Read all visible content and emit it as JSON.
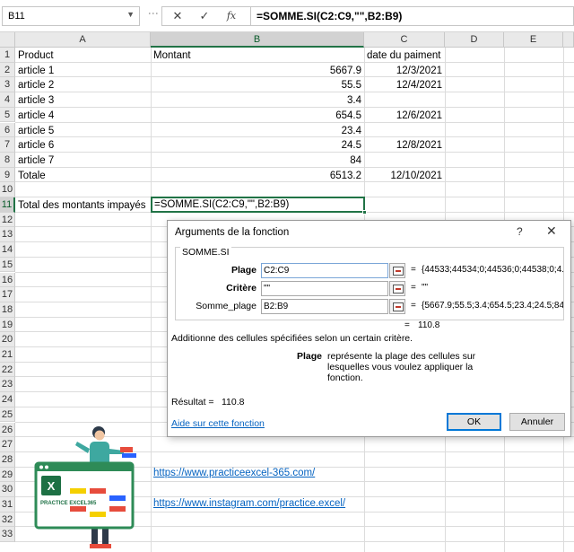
{
  "formula_bar": {
    "name_box": "B11",
    "cancel_glyph": "✕",
    "enter_glyph": "✓",
    "fx_glyph": "fx",
    "formula": "=SOMME.SI(C2:C9,\"\",B2:B9)"
  },
  "columns": [
    "A",
    "B",
    "C",
    "D",
    "E"
  ],
  "rows": [
    "1",
    "2",
    "3",
    "4",
    "5",
    "6",
    "7",
    "8",
    "9",
    "10",
    "11",
    "12",
    "13",
    "14",
    "15",
    "16",
    "17",
    "18",
    "19",
    "20",
    "21",
    "22",
    "23",
    "24",
    "25",
    "26",
    "27",
    "28",
    "29",
    "30",
    "31",
    "32",
    "33"
  ],
  "sheet": {
    "header": {
      "a": "Product",
      "b": "Montant",
      "c": "date du paiment"
    },
    "data": [
      {
        "a": "article 1",
        "b": "5667.9",
        "c": "12/3/2021"
      },
      {
        "a": "article 2",
        "b": "55.5",
        "c": "12/4/2021"
      },
      {
        "a": "article 3",
        "b": "3.4",
        "c": ""
      },
      {
        "a": "article 4",
        "b": "654.5",
        "c": "12/6/2021"
      },
      {
        "a": "article 5",
        "b": "23.4",
        "c": ""
      },
      {
        "a": "article 6",
        "b": "24.5",
        "c": "12/8/2021"
      },
      {
        "a": "article 7",
        "b": "84",
        "c": ""
      },
      {
        "a": "Totale",
        "b": "6513.2",
        "c": "12/10/2021"
      }
    ],
    "a11": "Total des montants impayés",
    "b11_editing": "=SOMME.SI(C2:C9,\"\",B2:B9)"
  },
  "links": {
    "website": "https://www.practiceexcel-365.com/",
    "instagram": "https://www.instagram.com/practice.excel/"
  },
  "logo_text": "PRACTICE EXCEL365",
  "dialog": {
    "title": "Arguments de la fonction",
    "help_glyph": "?",
    "close_glyph": "✕",
    "function_name": "SOMME.SI",
    "args": [
      {
        "label": "Plage",
        "input": "C2:C9",
        "result": "{44533;44534;0;44536;0;44538;0;4..."
      },
      {
        "label": "Critère",
        "input": "\"\"",
        "result": "\"\""
      },
      {
        "label": "Somme_plage",
        "input": "B2:B9",
        "result": "{5667.9;55.5;3.4;654.5;23.4;24.5;84;6..."
      }
    ],
    "equals": "=",
    "formula_result": "110.8",
    "description": "Additionne des cellules spécifiées selon un certain critère.",
    "param_name": "Plage",
    "param_description": "représente la plage des cellules sur lesquelles vous voulez appliquer la fonction.",
    "result_label": "Résultat =",
    "result_value": "110.8",
    "help_link": "Aide sur cette fonction",
    "ok_label": "OK",
    "cancel_label": "Annuler"
  }
}
